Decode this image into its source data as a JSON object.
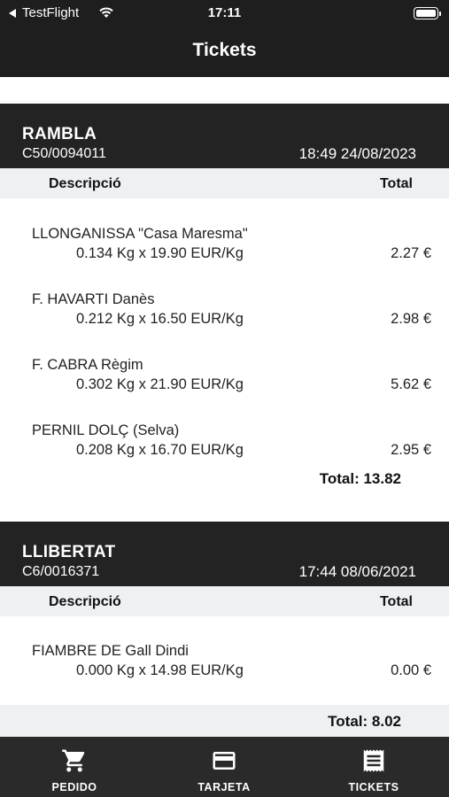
{
  "status": {
    "back_label": "TestFlight",
    "time": "17:11"
  },
  "nav": {
    "title": "Tickets"
  },
  "tickets": [
    {
      "store": "RAMBLA",
      "code": "C50/0094011",
      "datetime": "18:49 24/08/2023",
      "col_desc": "Descripció",
      "col_total": "Total",
      "lines": [
        {
          "name": "LLONGANISSA \"Casa Maresma\"",
          "qty": "0.134 Kg x  19.90 EUR/Kg",
          "amount": "2.27 €"
        },
        {
          "name": "F. HAVARTI Danès",
          "qty": "0.212 Kg x  16.50 EUR/Kg",
          "amount": "2.98 €"
        },
        {
          "name": "F. CABRA Règim",
          "qty": "0.302 Kg x  21.90 EUR/Kg",
          "amount": "5.62 €"
        },
        {
          "name": "PERNIL DOLÇ (Selva)",
          "qty": "0.208 Kg x  16.70 EUR/Kg",
          "amount": "2.95 €"
        }
      ],
      "total": "Total: 13.82"
    },
    {
      "store": "LLIBERTAT",
      "code": "C6/0016371",
      "datetime": "17:44 08/06/2021",
      "col_desc": "Descripció",
      "col_total": "Total",
      "lines": [
        {
          "name": "FIAMBRE DE Gall Dindi",
          "qty": "0.000 Kg x  14.98 EUR/Kg",
          "amount": "0.00 €"
        }
      ],
      "total": "Total: 8.02"
    }
  ],
  "tabbar": {
    "tabs": [
      {
        "label": "PEDIDO",
        "icon": "cart-icon"
      },
      {
        "label": "TARJETA",
        "icon": "card-icon"
      },
      {
        "label": "TICKETS",
        "icon": "receipt-icon"
      }
    ]
  },
  "colors": {
    "bar": "#1e1e1e",
    "header_row": "#eef0f3"
  }
}
